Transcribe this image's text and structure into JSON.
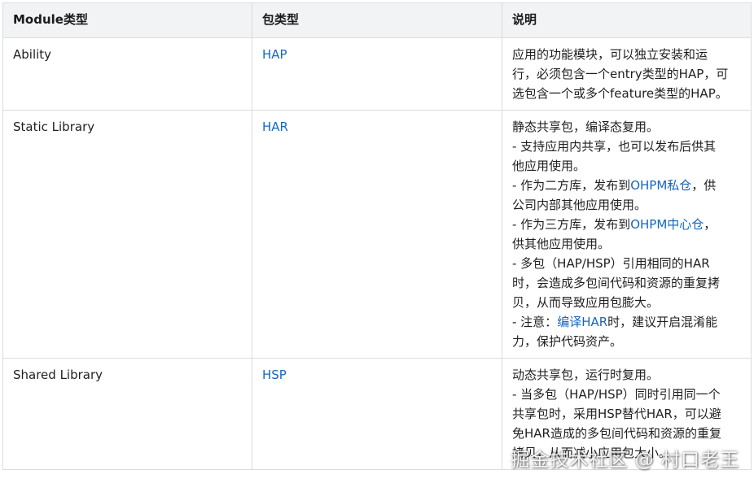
{
  "headers": [
    "Module类型",
    "包类型",
    "说明"
  ],
  "rows": [
    {
      "module": "Ability",
      "pkg": "HAP",
      "desc": [
        [
          {
            "t": "应用的功能模块，可以独立安装和运"
          }
        ],
        [
          {
            "t": "行，必须包含一个entry类型的HAP，可"
          }
        ],
        [
          {
            "t": "选包含一个或多个feature类型的HAP。"
          }
        ]
      ]
    },
    {
      "module": "Static Library",
      "pkg": "HAR",
      "desc": [
        [
          {
            "t": "静态共享包，编译态复用。"
          }
        ],
        [
          {
            "t": "- 支持应用内共享，也可以发布后供其"
          }
        ],
        [
          {
            "t": "他应用使用。"
          }
        ],
        [
          {
            "t": "- 作为二方库，发布到"
          },
          {
            "t": "OHPM私仓",
            "link": true
          },
          {
            "t": "，供"
          }
        ],
        [
          {
            "t": "公司内部其他应用使用。"
          }
        ],
        [
          {
            "t": "- 作为三方库，发布到"
          },
          {
            "t": "OHPM中心仓",
            "link": true
          },
          {
            "t": "，"
          }
        ],
        [
          {
            "t": "供其他应用使用。"
          }
        ],
        [
          {
            "t": "- 多包（HAP/HSP）引用相同的HAR"
          }
        ],
        [
          {
            "t": "时，会造成多包间代码和资源的重复拷"
          }
        ],
        [
          {
            "t": "贝，从而导致应用包膨大。"
          }
        ],
        [
          {
            "t": "- 注意："
          },
          {
            "t": "编译HAR",
            "link": true
          },
          {
            "t": "时，建议开启混淆能"
          }
        ],
        [
          {
            "t": "力，保护代码资产。"
          }
        ]
      ]
    },
    {
      "module": "Shared Library",
      "pkg": "HSP",
      "desc": [
        [
          {
            "t": "动态共享包，运行时复用。"
          }
        ],
        [
          {
            "t": "- 当多包（HAP/HSP）同时引用同一个"
          }
        ],
        [
          {
            "t": "共享包时，采用HSP替代HAR，可以避"
          }
        ],
        [
          {
            "t": "免HAR造成的多包间代码和资源的重复"
          }
        ],
        [
          {
            "t": "拷贝，从而减小应用包大小。"
          }
        ]
      ]
    }
  ],
  "watermark": "掘金技术社区 @ 村口老王",
  "colors": {
    "link": "#1565c0",
    "header_bg": "#f2f3f5",
    "border": "#dcdcdc"
  }
}
